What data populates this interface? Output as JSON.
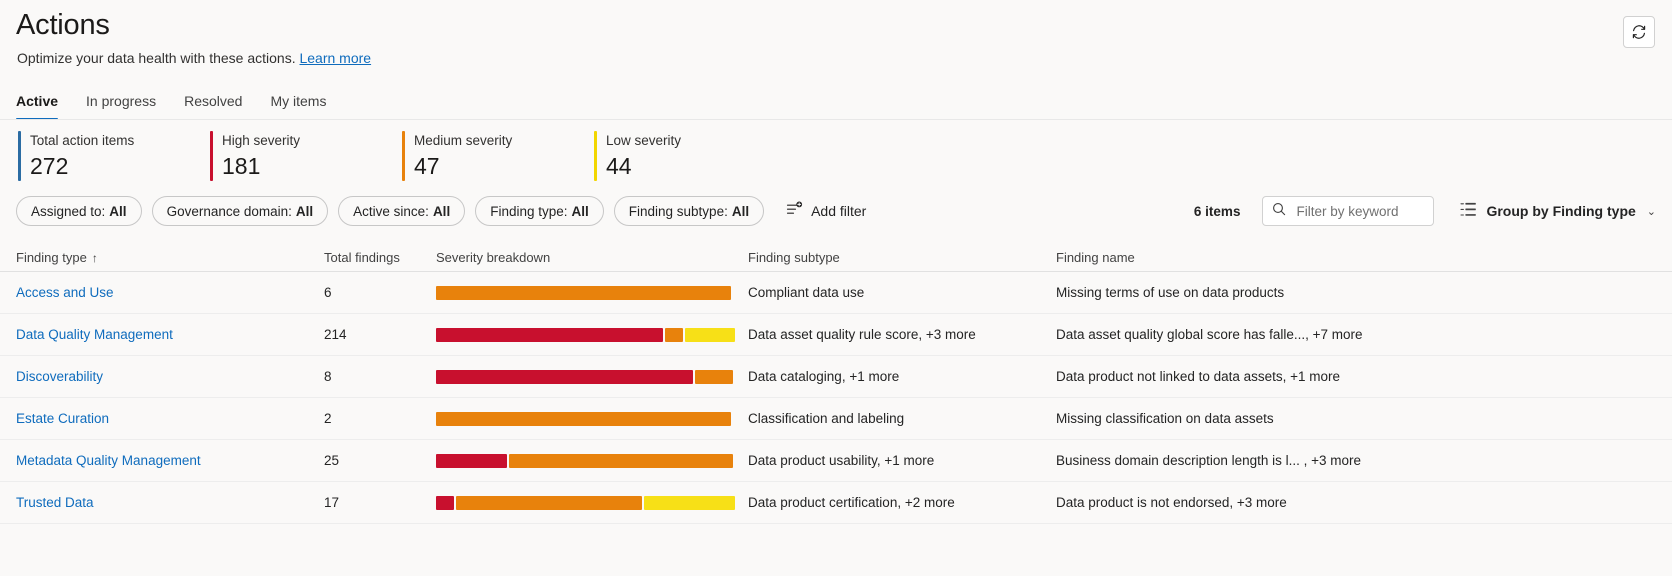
{
  "header": {
    "title": "Actions",
    "subtitle_text": "Optimize your data health with these actions.",
    "learn_more": "Learn more",
    "refresh_icon": "refresh-icon"
  },
  "tabs": [
    {
      "label": "Active",
      "active": true
    },
    {
      "label": "In progress",
      "active": false
    },
    {
      "label": "Resolved",
      "active": false
    },
    {
      "label": "My items",
      "active": false
    }
  ],
  "stats": [
    {
      "label": "Total action items",
      "value": "272",
      "color": "#2b6ca3"
    },
    {
      "label": "High severity",
      "value": "181",
      "color": "#c8102e"
    },
    {
      "label": "Medium severity",
      "value": "47",
      "color": "#e8820c"
    },
    {
      "label": "Low severity",
      "value": "44",
      "color": "#f2d600"
    }
  ],
  "filters": [
    {
      "label": "Assigned to:",
      "value": "All"
    },
    {
      "label": "Governance domain:",
      "value": "All"
    },
    {
      "label": "Active since:",
      "value": "All"
    },
    {
      "label": "Finding type:",
      "value": "All"
    },
    {
      "label": "Finding subtype:",
      "value": "All"
    }
  ],
  "add_filter": {
    "label": "Add filter",
    "icon": "add-filter-icon"
  },
  "toolbar_right": {
    "item_count": "6 items",
    "search_placeholder": "Filter by keyword",
    "search_value": "",
    "search_icon": "search-icon",
    "group_by_label": "Group by Finding type",
    "group_by_icon": "group-by-icon",
    "chevron": "⌄"
  },
  "table": {
    "columns": [
      {
        "key": "finding_type",
        "label": "Finding type",
        "sort": "↑"
      },
      {
        "key": "total_findings",
        "label": "Total findings"
      },
      {
        "key": "severity_breakdown",
        "label": "Severity breakdown"
      },
      {
        "key": "finding_subtype",
        "label": "Finding subtype"
      },
      {
        "key": "finding_name",
        "label": "Finding name"
      }
    ],
    "severity_colors": {
      "high": "#c8102e",
      "medium": "#e8820c",
      "low": "#f7e017"
    },
    "rows": [
      {
        "finding_type": "Access and Use",
        "total_findings": "6",
        "severity": [
          {
            "level": "medium",
            "pct": 100
          }
        ],
        "finding_subtype": "Compliant data use",
        "finding_name": "Missing terms of use on data products"
      },
      {
        "finding_type": "Data Quality Management",
        "total_findings": "214",
        "severity": [
          {
            "level": "high",
            "pct": 77
          },
          {
            "level": "medium",
            "pct": 6
          },
          {
            "level": "low",
            "pct": 17
          }
        ],
        "finding_subtype": "Data asset quality rule score, +3 more",
        "finding_name": "Data asset quality global score has falle..., +7 more"
      },
      {
        "finding_type": "Discoverability",
        "total_findings": "8",
        "severity": [
          {
            "level": "high",
            "pct": 87
          },
          {
            "level": "medium",
            "pct": 13
          }
        ],
        "finding_subtype": "Data cataloging, +1 more",
        "finding_name": "Data product not linked to data assets, +1 more"
      },
      {
        "finding_type": "Estate Curation",
        "total_findings": "2",
        "severity": [
          {
            "level": "medium",
            "pct": 100
          }
        ],
        "finding_subtype": "Classification and labeling",
        "finding_name": "Missing classification on data assets"
      },
      {
        "finding_type": "Metadata Quality Management",
        "total_findings": "25",
        "severity": [
          {
            "level": "high",
            "pct": 24
          },
          {
            "level": "medium",
            "pct": 76
          }
        ],
        "finding_subtype": "Data product usability, +1 more",
        "finding_name": "Business domain description length is l... , +3 more"
      },
      {
        "finding_type": "Trusted Data",
        "total_findings": "17",
        "severity": [
          {
            "level": "high",
            "pct": 6
          },
          {
            "level": "medium",
            "pct": 63
          },
          {
            "level": "low",
            "pct": 31
          }
        ],
        "finding_subtype": "Data product certification, +2 more",
        "finding_name": "Data product is not endorsed, +3 more"
      }
    ]
  }
}
